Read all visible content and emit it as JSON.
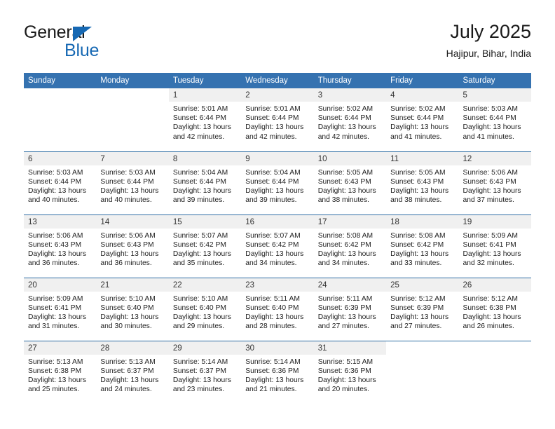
{
  "brand": {
    "name_top": "General",
    "name_bottom": "Blue",
    "accent_color": "#1668b3"
  },
  "header": {
    "title": "July 2025",
    "location": "Hajipur, Bihar, India"
  },
  "theme": {
    "header_row_bg": "#3572b0",
    "week_divider": "#2e6da4",
    "daynum_band_bg": "#f0f0f0",
    "text_color": "#222222"
  },
  "weekday_headers": [
    "Sunday",
    "Monday",
    "Tuesday",
    "Wednesday",
    "Thursday",
    "Friday",
    "Saturday"
  ],
  "weeks": [
    [
      {
        "day": "",
        "lines": [
          "",
          "",
          "",
          ""
        ]
      },
      {
        "day": "",
        "lines": [
          "",
          "",
          "",
          ""
        ]
      },
      {
        "day": "1",
        "lines": [
          "Sunrise: 5:01 AM",
          "Sunset: 6:44 PM",
          "Daylight: 13 hours",
          "and 42 minutes."
        ]
      },
      {
        "day": "2",
        "lines": [
          "Sunrise: 5:01 AM",
          "Sunset: 6:44 PM",
          "Daylight: 13 hours",
          "and 42 minutes."
        ]
      },
      {
        "day": "3",
        "lines": [
          "Sunrise: 5:02 AM",
          "Sunset: 6:44 PM",
          "Daylight: 13 hours",
          "and 42 minutes."
        ]
      },
      {
        "day": "4",
        "lines": [
          "Sunrise: 5:02 AM",
          "Sunset: 6:44 PM",
          "Daylight: 13 hours",
          "and 41 minutes."
        ]
      },
      {
        "day": "5",
        "lines": [
          "Sunrise: 5:03 AM",
          "Sunset: 6:44 PM",
          "Daylight: 13 hours",
          "and 41 minutes."
        ]
      }
    ],
    [
      {
        "day": "6",
        "lines": [
          "Sunrise: 5:03 AM",
          "Sunset: 6:44 PM",
          "Daylight: 13 hours",
          "and 40 minutes."
        ]
      },
      {
        "day": "7",
        "lines": [
          "Sunrise: 5:03 AM",
          "Sunset: 6:44 PM",
          "Daylight: 13 hours",
          "and 40 minutes."
        ]
      },
      {
        "day": "8",
        "lines": [
          "Sunrise: 5:04 AM",
          "Sunset: 6:44 PM",
          "Daylight: 13 hours",
          "and 39 minutes."
        ]
      },
      {
        "day": "9",
        "lines": [
          "Sunrise: 5:04 AM",
          "Sunset: 6:44 PM",
          "Daylight: 13 hours",
          "and 39 minutes."
        ]
      },
      {
        "day": "10",
        "lines": [
          "Sunrise: 5:05 AM",
          "Sunset: 6:43 PM",
          "Daylight: 13 hours",
          "and 38 minutes."
        ]
      },
      {
        "day": "11",
        "lines": [
          "Sunrise: 5:05 AM",
          "Sunset: 6:43 PM",
          "Daylight: 13 hours",
          "and 38 minutes."
        ]
      },
      {
        "day": "12",
        "lines": [
          "Sunrise: 5:06 AM",
          "Sunset: 6:43 PM",
          "Daylight: 13 hours",
          "and 37 minutes."
        ]
      }
    ],
    [
      {
        "day": "13",
        "lines": [
          "Sunrise: 5:06 AM",
          "Sunset: 6:43 PM",
          "Daylight: 13 hours",
          "and 36 minutes."
        ]
      },
      {
        "day": "14",
        "lines": [
          "Sunrise: 5:06 AM",
          "Sunset: 6:43 PM",
          "Daylight: 13 hours",
          "and 36 minutes."
        ]
      },
      {
        "day": "15",
        "lines": [
          "Sunrise: 5:07 AM",
          "Sunset: 6:42 PM",
          "Daylight: 13 hours",
          "and 35 minutes."
        ]
      },
      {
        "day": "16",
        "lines": [
          "Sunrise: 5:07 AM",
          "Sunset: 6:42 PM",
          "Daylight: 13 hours",
          "and 34 minutes."
        ]
      },
      {
        "day": "17",
        "lines": [
          "Sunrise: 5:08 AM",
          "Sunset: 6:42 PM",
          "Daylight: 13 hours",
          "and 34 minutes."
        ]
      },
      {
        "day": "18",
        "lines": [
          "Sunrise: 5:08 AM",
          "Sunset: 6:42 PM",
          "Daylight: 13 hours",
          "and 33 minutes."
        ]
      },
      {
        "day": "19",
        "lines": [
          "Sunrise: 5:09 AM",
          "Sunset: 6:41 PM",
          "Daylight: 13 hours",
          "and 32 minutes."
        ]
      }
    ],
    [
      {
        "day": "20",
        "lines": [
          "Sunrise: 5:09 AM",
          "Sunset: 6:41 PM",
          "Daylight: 13 hours",
          "and 31 minutes."
        ]
      },
      {
        "day": "21",
        "lines": [
          "Sunrise: 5:10 AM",
          "Sunset: 6:40 PM",
          "Daylight: 13 hours",
          "and 30 minutes."
        ]
      },
      {
        "day": "22",
        "lines": [
          "Sunrise: 5:10 AM",
          "Sunset: 6:40 PM",
          "Daylight: 13 hours",
          "and 29 minutes."
        ]
      },
      {
        "day": "23",
        "lines": [
          "Sunrise: 5:11 AM",
          "Sunset: 6:40 PM",
          "Daylight: 13 hours",
          "and 28 minutes."
        ]
      },
      {
        "day": "24",
        "lines": [
          "Sunrise: 5:11 AM",
          "Sunset: 6:39 PM",
          "Daylight: 13 hours",
          "and 27 minutes."
        ]
      },
      {
        "day": "25",
        "lines": [
          "Sunrise: 5:12 AM",
          "Sunset: 6:39 PM",
          "Daylight: 13 hours",
          "and 27 minutes."
        ]
      },
      {
        "day": "26",
        "lines": [
          "Sunrise: 5:12 AM",
          "Sunset: 6:38 PM",
          "Daylight: 13 hours",
          "and 26 minutes."
        ]
      }
    ],
    [
      {
        "day": "27",
        "lines": [
          "Sunrise: 5:13 AM",
          "Sunset: 6:38 PM",
          "Daylight: 13 hours",
          "and 25 minutes."
        ]
      },
      {
        "day": "28",
        "lines": [
          "Sunrise: 5:13 AM",
          "Sunset: 6:37 PM",
          "Daylight: 13 hours",
          "and 24 minutes."
        ]
      },
      {
        "day": "29",
        "lines": [
          "Sunrise: 5:14 AM",
          "Sunset: 6:37 PM",
          "Daylight: 13 hours",
          "and 23 minutes."
        ]
      },
      {
        "day": "30",
        "lines": [
          "Sunrise: 5:14 AM",
          "Sunset: 6:36 PM",
          "Daylight: 13 hours",
          "and 21 minutes."
        ]
      },
      {
        "day": "31",
        "lines": [
          "Sunrise: 5:15 AM",
          "Sunset: 6:36 PM",
          "Daylight: 13 hours",
          "and 20 minutes."
        ]
      },
      {
        "day": "",
        "lines": [
          "",
          "",
          "",
          ""
        ]
      },
      {
        "day": "",
        "lines": [
          "",
          "",
          "",
          ""
        ]
      }
    ]
  ]
}
